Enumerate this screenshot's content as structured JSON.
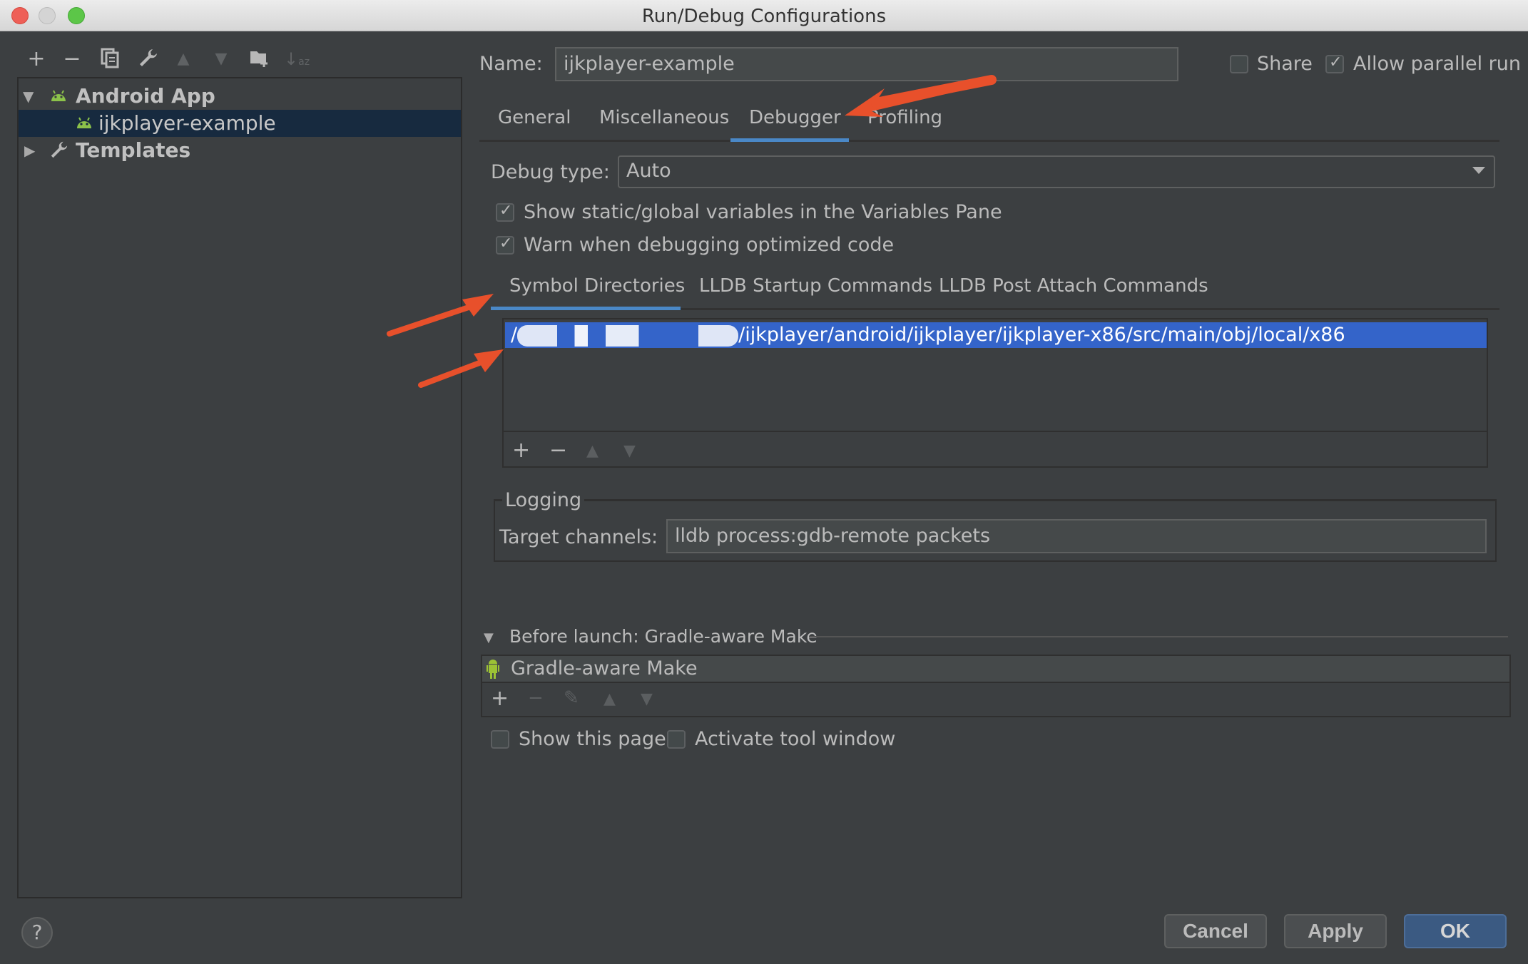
{
  "window": {
    "title": "Run/Debug Configurations"
  },
  "left_toolbar": {
    "icons": [
      "add-icon",
      "remove-icon",
      "copy-icon",
      "wrench-icon",
      "move-up-icon",
      "move-down-icon",
      "new-folder-icon",
      "sort-alpha-icon"
    ],
    "glyphs": [
      "+",
      "−",
      "⧉",
      "🔧",
      "▲",
      "▼",
      "📁",
      "↓"
    ]
  },
  "tree": {
    "items": [
      {
        "label": "Android App",
        "expanded": true,
        "level": 0,
        "icon": "android-icon"
      },
      {
        "label": "ijkplayer-example",
        "selected": true,
        "level": 1,
        "icon": "android-icon"
      },
      {
        "label": "Templates",
        "expanded": false,
        "level": 0,
        "icon": "wrench-icon"
      }
    ]
  },
  "config": {
    "name_label": "Name:",
    "name_value": "ijkplayer-example",
    "share_label": "Share",
    "share_checked": false,
    "parallel_label": "Allow parallel run",
    "parallel_checked": true
  },
  "tabs": {
    "items": [
      "General",
      "Miscellaneous",
      "Debugger",
      "Profiling"
    ],
    "active": "Debugger"
  },
  "debugger": {
    "debug_type_label": "Debug type:",
    "debug_type_value": "Auto",
    "show_static_label": "Show static/global variables in the Variables Pane",
    "show_static_checked": true,
    "warn_optimized_label": "Warn when debugging optimized code",
    "warn_optimized_checked": true,
    "subtabs": {
      "items": [
        "Symbol Directories",
        "LLDB Startup Commands",
        "LLDB Post Attach Commands"
      ],
      "active": "Symbol Directories"
    },
    "symbol_directories": [
      {
        "prefix": "/",
        "redacted": true,
        "path": "/ijkplayer/android/ijkplayer/ijkplayer-x86/src/main/obj/local/x86"
      }
    ],
    "list_toolbar": [
      "+",
      "−",
      "▲",
      "▼"
    ],
    "logging": {
      "title": "Logging",
      "target_channels_label": "Target channels:",
      "target_channels_value": "lldb process:gdb-remote packets"
    }
  },
  "before_launch": {
    "title": "Before launch: Gradle-aware Make",
    "items": [
      "Gradle-aware Make"
    ],
    "toolbar": [
      "+",
      "−",
      "✎",
      "▲",
      "▼"
    ],
    "show_page_label": "Show this page",
    "show_page_checked": false,
    "activate_tool_label": "Activate tool window",
    "activate_tool_checked": false
  },
  "footer": {
    "help": "?",
    "cancel": "Cancel",
    "apply": "Apply",
    "ok": "OK"
  },
  "annotation_color": "#e8502b",
  "selection_color": "#3464c9",
  "accent_color": "#4a88c7"
}
